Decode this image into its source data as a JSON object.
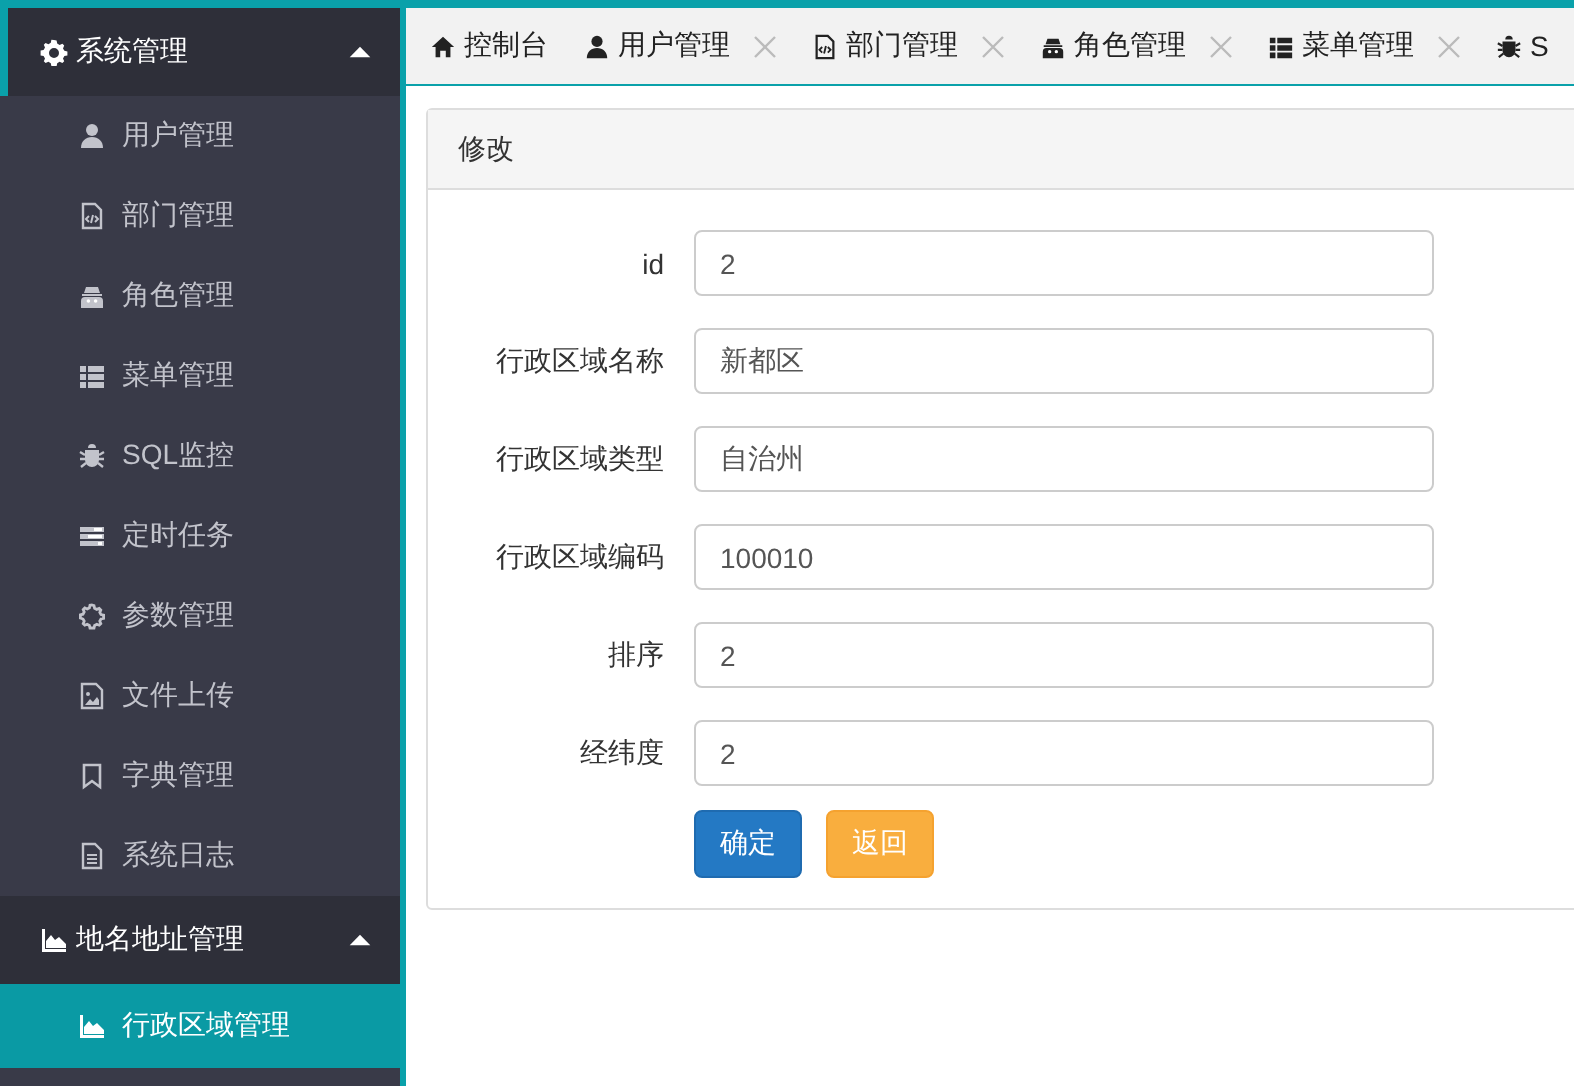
{
  "sidebar": {
    "groups": [
      {
        "label": "系统管理",
        "expanded": true,
        "items": [
          {
            "label": "用户管理",
            "selected": false
          },
          {
            "label": "部门管理",
            "selected": false
          },
          {
            "label": "角色管理",
            "selected": false
          },
          {
            "label": "菜单管理",
            "selected": false
          },
          {
            "label": "SQL监控",
            "selected": false
          },
          {
            "label": "定时任务",
            "selected": false
          },
          {
            "label": "参数管理",
            "selected": false
          },
          {
            "label": "文件上传",
            "selected": false
          },
          {
            "label": "字典管理",
            "selected": false
          },
          {
            "label": "系统日志",
            "selected": false
          }
        ]
      },
      {
        "label": "地名地址管理",
        "expanded": true,
        "items": [
          {
            "label": "行政区域管理",
            "selected": true
          }
        ]
      }
    ]
  },
  "tabs": [
    {
      "label": "控制台",
      "closable": false
    },
    {
      "label": "用户管理",
      "closable": true
    },
    {
      "label": "部门管理",
      "closable": true
    },
    {
      "label": "角色管理",
      "closable": true
    },
    {
      "label": "菜单管理",
      "closable": true
    },
    {
      "label": "S",
      "closable": false
    }
  ],
  "panel": {
    "title": "修改",
    "fields": [
      {
        "label": "id",
        "value": "2"
      },
      {
        "label": "行政区域名称",
        "value": "新都区"
      },
      {
        "label": "行政区域类型",
        "value": "自治州"
      },
      {
        "label": "行政区域编码",
        "value": "100010"
      },
      {
        "label": "排序",
        "value": "2"
      },
      {
        "label": "经纬度",
        "value": "2"
      }
    ],
    "buttons": [
      {
        "label": "确定",
        "kind": "primary"
      },
      {
        "label": "返回",
        "kind": "warning"
      }
    ]
  }
}
